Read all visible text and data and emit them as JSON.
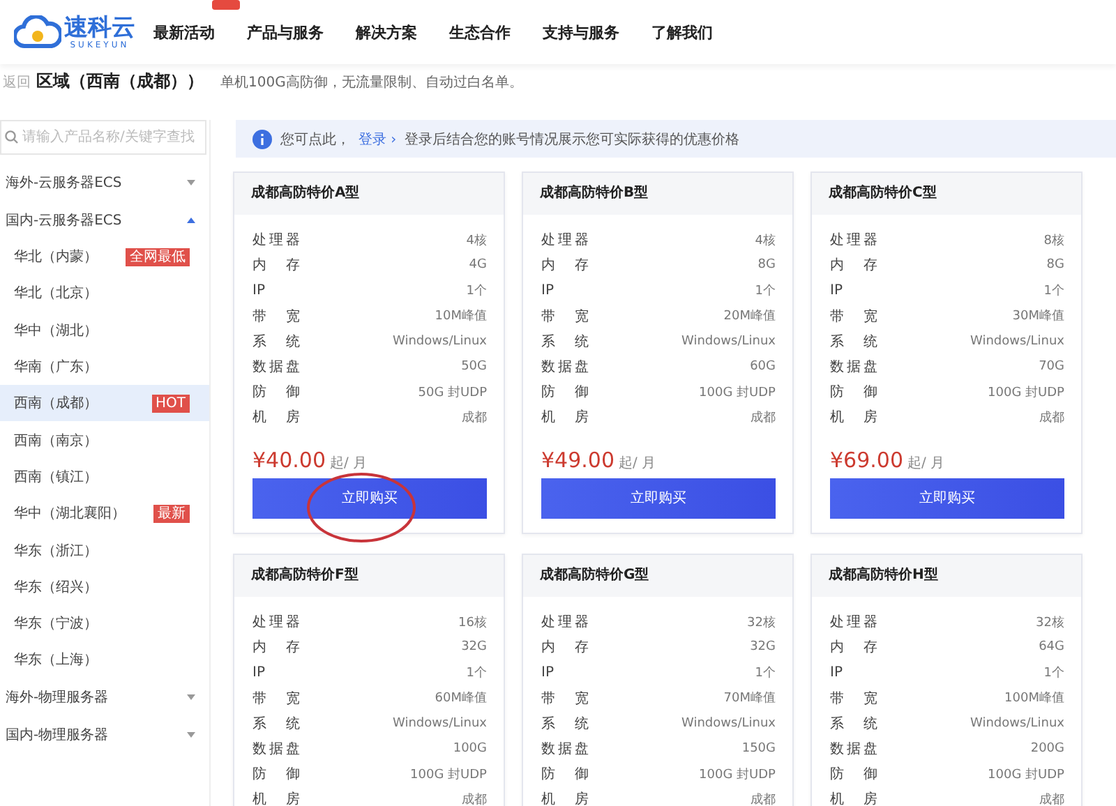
{
  "header": {
    "logo": {
      "name": "速科云",
      "tagline": "SUKEYUN"
    },
    "nav": [
      {
        "label": "最新活动",
        "badge": true
      },
      {
        "label": "产品与服务",
        "badge": false
      },
      {
        "label": "解决方案",
        "badge": false
      },
      {
        "label": "生态合作",
        "badge": false
      },
      {
        "label": "支持与服务",
        "badge": false
      },
      {
        "label": "了解我们",
        "badge": false
      }
    ]
  },
  "breadcrumb": {
    "back": "返回",
    "title": "区域（西南（成都））",
    "description": "单机100G高防御，无流量限制、自动过白名单。"
  },
  "sidebar": {
    "search": {
      "placeholder": "请输入产品名称/关键字查找"
    },
    "groups": [
      {
        "label": "海外-云服务器ECS",
        "expanded": false
      },
      {
        "label": "国内-云服务器ECS",
        "expanded": true,
        "children": [
          {
            "label": "华北（内蒙）",
            "selected": false,
            "badge": "全网最低"
          },
          {
            "label": "华北（北京）",
            "selected": false
          },
          {
            "label": "华中（湖北）",
            "selected": false
          },
          {
            "label": "华南（广东）",
            "selected": false
          },
          {
            "label": "西南（成都）",
            "selected": true,
            "badge": "HOT"
          },
          {
            "label": "西南（南京）",
            "selected": false
          },
          {
            "label": "西南（镇江）",
            "selected": false
          },
          {
            "label": "华中（湖北襄阳）",
            "selected": false,
            "badge": "最新"
          },
          {
            "label": "华东（浙江）",
            "selected": false
          },
          {
            "label": "华东（绍兴）",
            "selected": false
          },
          {
            "label": "华东（宁波）",
            "selected": false
          },
          {
            "label": "华东（上海）",
            "selected": false
          }
        ]
      },
      {
        "label": "海外-物理服务器",
        "expanded": false
      },
      {
        "label": "国内-物理服务器",
        "expanded": false
      }
    ]
  },
  "notice": {
    "lead": "您可点此，",
    "link": "登录 ›",
    "text": "登录后结合您的账号情况展示您可实际获得的优惠价格"
  },
  "cards": [
    {
      "title": "成都高防特价A型",
      "specs": [
        [
          "处理器",
          "4核"
        ],
        [
          "内存",
          "4G"
        ],
        [
          "IP",
          "1个"
        ],
        [
          "带宽",
          "10M峰值"
        ],
        [
          "系统",
          "Windows/Linux"
        ],
        [
          "数据盘",
          "50G"
        ],
        [
          "防御",
          "50G 封UDP"
        ],
        [
          "机房",
          "成都"
        ]
      ],
      "price": "¥40.00",
      "unit": "起/ 月",
      "button": "立即购买",
      "circled": true
    },
    {
      "title": "成都高防特价B型",
      "specs": [
        [
          "处理器",
          "4核"
        ],
        [
          "内存",
          "8G"
        ],
        [
          "IP",
          "1个"
        ],
        [
          "带宽",
          "20M峰值"
        ],
        [
          "系统",
          "Windows/Linux"
        ],
        [
          "数据盘",
          "60G"
        ],
        [
          "防御",
          "100G 封UDP"
        ],
        [
          "机房",
          "成都"
        ]
      ],
      "price": "¥49.00",
      "unit": "起/ 月",
      "button": "立即购买",
      "circled": false
    },
    {
      "title": "成都高防特价C型",
      "specs": [
        [
          "处理器",
          "8核"
        ],
        [
          "内存",
          "8G"
        ],
        [
          "IP",
          "1个"
        ],
        [
          "带宽",
          "30M峰值"
        ],
        [
          "系统",
          "Windows/Linux"
        ],
        [
          "数据盘",
          "70G"
        ],
        [
          "防御",
          "100G 封UDP"
        ],
        [
          "机房",
          "成都"
        ]
      ],
      "price": "¥69.00",
      "unit": "起/ 月",
      "button": "立即购买",
      "circled": false
    },
    {
      "title": "成都高防特价F型",
      "specs": [
        [
          "处理器",
          "16核"
        ],
        [
          "内存",
          "32G"
        ],
        [
          "IP",
          "1个"
        ],
        [
          "带宽",
          "60M峰值"
        ],
        [
          "系统",
          "Windows/Linux"
        ],
        [
          "数据盘",
          "100G"
        ],
        [
          "防御",
          "100G 封UDP"
        ],
        [
          "机房",
          "成都"
        ]
      ]
    },
    {
      "title": "成都高防特价G型",
      "specs": [
        [
          "处理器",
          "32核"
        ],
        [
          "内存",
          "32G"
        ],
        [
          "IP",
          "1个"
        ],
        [
          "带宽",
          "70M峰值"
        ],
        [
          "系统",
          "Windows/Linux"
        ],
        [
          "数据盘",
          "150G"
        ],
        [
          "防御",
          "100G 封UDP"
        ],
        [
          "机房",
          "成都"
        ]
      ]
    },
    {
      "title": "成都高防特价H型",
      "specs": [
        [
          "处理器",
          "32核"
        ],
        [
          "内存",
          "64G"
        ],
        [
          "IP",
          "1个"
        ],
        [
          "带宽",
          "100M峰值"
        ],
        [
          "系统",
          "Windows/Linux"
        ],
        [
          "数据盘",
          "200G"
        ],
        [
          "防御",
          "100G 封UDP"
        ],
        [
          "机房",
          "成都"
        ]
      ]
    }
  ]
}
